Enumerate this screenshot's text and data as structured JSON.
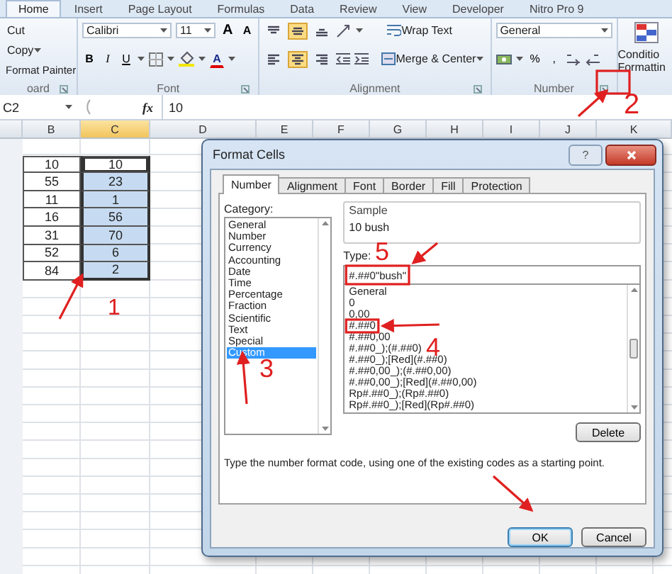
{
  "ribbon_tabs": [
    {
      "label": "Home",
      "selected": true
    },
    {
      "label": "Insert",
      "selected": false
    },
    {
      "label": "Page Layout",
      "selected": false
    },
    {
      "label": "Formulas",
      "selected": false
    },
    {
      "label": "Data",
      "selected": false
    },
    {
      "label": "Review",
      "selected": false
    },
    {
      "label": "View",
      "selected": false
    },
    {
      "label": "Developer",
      "selected": false
    },
    {
      "label": "Nitro Pro 9",
      "selected": false
    }
  ],
  "clipboard": {
    "cut": "Cut",
    "copy": "Copy",
    "format_painter": "Format Painter",
    "group_label": "oard"
  },
  "font": {
    "name": "Calibri",
    "size": "11",
    "grow": "A",
    "shrink": "A",
    "bold": "B",
    "italic": "I",
    "underline": "U",
    "color_letter": "A",
    "group_label": "Font"
  },
  "alignment": {
    "buttons": [
      {
        "kind": "top",
        "selected": false
      },
      {
        "kind": "middle",
        "selected": true
      },
      {
        "kind": "bottom",
        "selected": false
      },
      {
        "kind": "left",
        "selected": false
      },
      {
        "kind": "center",
        "selected": true
      },
      {
        "kind": "right",
        "selected": false
      }
    ],
    "wrap_text": "Wrap Text",
    "merge": "Merge & Center",
    "group_label": "Alignment"
  },
  "number": {
    "format": "General",
    "percent": "%",
    "comma": ",",
    "group_label": "Number"
  },
  "styles": {
    "conditional_formatting": [
      "Conditio",
      "Formattin"
    ]
  },
  "formula_bar": {
    "name_box": "C2",
    "function_label": "fx",
    "value": "10"
  },
  "sheet": {
    "columns": [
      {
        "label": "B",
        "selected": false
      },
      {
        "label": "C",
        "selected": true
      },
      {
        "label": "D",
        "selected": false
      },
      {
        "label": "E",
        "selected": false
      },
      {
        "label": "F",
        "selected": false
      },
      {
        "label": "G",
        "selected": false
      },
      {
        "label": "H",
        "selected": false
      },
      {
        "label": "I",
        "selected": false
      },
      {
        "label": "J",
        "selected": false
      },
      {
        "label": "K",
        "selected": false
      }
    ],
    "rows": [
      {
        "b": "10",
        "c": "10",
        "selected": true,
        "active": true
      },
      {
        "b": "55",
        "c": "23",
        "selected": true,
        "active": false
      },
      {
        "b": "11",
        "c": "1",
        "selected": true,
        "active": false
      },
      {
        "b": "16",
        "c": "56",
        "selected": true,
        "active": false
      },
      {
        "b": "31",
        "c": "70",
        "selected": true,
        "active": false
      },
      {
        "b": "52",
        "c": "6",
        "selected": true,
        "active": false
      },
      {
        "b": "84",
        "c": "2",
        "selected": true,
        "active": false
      }
    ]
  },
  "dialog": {
    "title": "Format Cells",
    "help": "?",
    "tabs": [
      {
        "label": "Number",
        "selected": true
      },
      {
        "label": "Alignment",
        "selected": false
      },
      {
        "label": "Font",
        "selected": false
      },
      {
        "label": "Border",
        "selected": false
      },
      {
        "label": "Fill",
        "selected": false
      },
      {
        "label": "Protection",
        "selected": false
      }
    ],
    "category_label": "Category:",
    "categories": [
      {
        "label": "General",
        "selected": false
      },
      {
        "label": "Number",
        "selected": false
      },
      {
        "label": "Currency",
        "selected": false
      },
      {
        "label": "Accounting",
        "selected": false
      },
      {
        "label": "Date",
        "selected": false
      },
      {
        "label": "Time",
        "selected": false
      },
      {
        "label": "Percentage",
        "selected": false
      },
      {
        "label": "Fraction",
        "selected": false
      },
      {
        "label": "Scientific",
        "selected": false
      },
      {
        "label": "Text",
        "selected": false
      },
      {
        "label": "Special",
        "selected": false
      },
      {
        "label": "Custom",
        "selected": true
      }
    ],
    "sample_label": "Sample",
    "sample": "10 bush",
    "type_label": "Type:",
    "type_value": "#.##0\"bush\"",
    "formats": [
      "General",
      "0",
      "0,00",
      "#.##0",
      "#.##0,00",
      "#.##0_);(#.##0)",
      "#.##0_);[Red](#.##0)",
      "#.##0,00_);(#.##0,00)",
      "#.##0,00_);[Red](#.##0,00)",
      "Rp#.##0_);(Rp#.##0)",
      "Rp#.##0_);[Red](Rp#.##0)"
    ],
    "delete": "Delete",
    "description": "Type the number format code, using one of the existing codes as a starting point.",
    "ok": "OK",
    "cancel": "Cancel"
  },
  "annotations": [
    {
      "label": "1"
    },
    {
      "label": "2"
    },
    {
      "label": "3"
    },
    {
      "label": "4"
    },
    {
      "label": "5"
    }
  ]
}
